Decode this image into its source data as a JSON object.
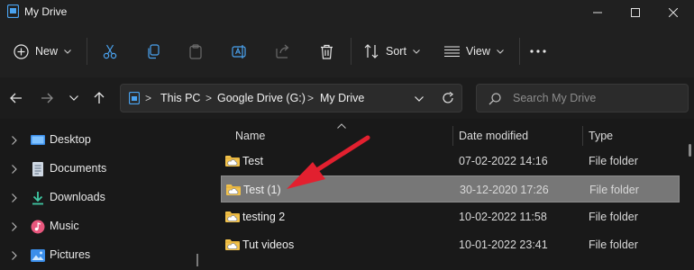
{
  "window": {
    "title": "My Drive"
  },
  "toolbar": {
    "new_label": "New",
    "sort_label": "Sort",
    "view_label": "View"
  },
  "address": {
    "crumbs": [
      "This PC",
      "Google Drive (G:)",
      "My Drive"
    ],
    "separator": ">"
  },
  "search": {
    "placeholder": "Search My Drive"
  },
  "sidebar": {
    "items": [
      {
        "label": "Desktop",
        "icon": "desktop-icon"
      },
      {
        "label": "Documents",
        "icon": "documents-icon"
      },
      {
        "label": "Downloads",
        "icon": "downloads-icon"
      },
      {
        "label": "Music",
        "icon": "music-icon"
      },
      {
        "label": "Pictures",
        "icon": "pictures-icon"
      }
    ]
  },
  "columns": {
    "name": "Name",
    "date": "Date modified",
    "type": "Type"
  },
  "files": [
    {
      "name": "Test",
      "date": "07-02-2022 14:16",
      "type": "File folder",
      "selected": false
    },
    {
      "name": "Test (1)",
      "date": "30-12-2020 17:26",
      "type": "File folder",
      "selected": true
    },
    {
      "name": "testing 2",
      "date": "10-02-2022 11:58",
      "type": "File folder",
      "selected": false
    },
    {
      "name": "Tut videos",
      "date": "10-01-2022 23:41",
      "type": "File folder",
      "selected": false
    }
  ],
  "colors": {
    "accent": "#3b8eea",
    "annotation": "#e2202f",
    "selection": "#777777",
    "folder": "#f2c24b"
  }
}
